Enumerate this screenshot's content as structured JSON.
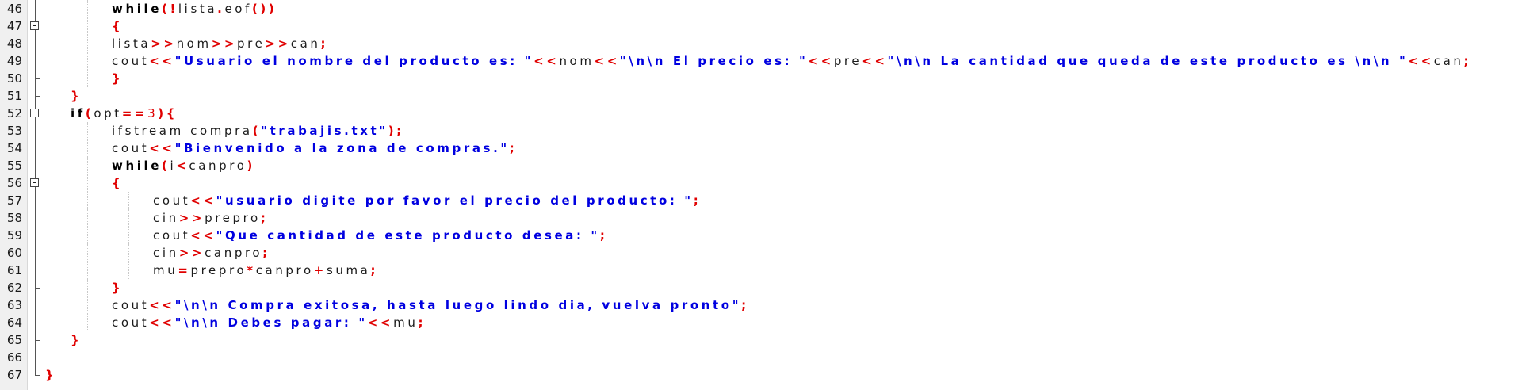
{
  "editor": {
    "lines": [
      {
        "num": "46",
        "indent": 2,
        "fold": "line",
        "tokens": [
          {
            "t": "kw",
            "v": "while"
          },
          {
            "t": "op",
            "v": "(!"
          },
          {
            "t": "id",
            "v": "lista"
          },
          {
            "t": "op",
            "v": "."
          },
          {
            "t": "id",
            "v": "eof"
          },
          {
            "t": "op",
            "v": "())"
          }
        ]
      },
      {
        "num": "47",
        "indent": 2,
        "fold": "box",
        "tokens": [
          {
            "t": "op",
            "v": "{"
          }
        ]
      },
      {
        "num": "48",
        "indent": 2,
        "fold": "line",
        "tokens": [
          {
            "t": "id",
            "v": "lista"
          },
          {
            "t": "op",
            "v": ">>"
          },
          {
            "t": "id",
            "v": "nom"
          },
          {
            "t": "op",
            "v": ">>"
          },
          {
            "t": "id",
            "v": "pre"
          },
          {
            "t": "op",
            "v": ">>"
          },
          {
            "t": "id",
            "v": "can"
          },
          {
            "t": "op",
            "v": ";"
          }
        ]
      },
      {
        "num": "49",
        "indent": 2,
        "fold": "line",
        "tokens": [
          {
            "t": "id",
            "v": "cout"
          },
          {
            "t": "op",
            "v": "<<"
          },
          {
            "t": "str",
            "v": "\"Usuario el nombre del producto es: \""
          },
          {
            "t": "op",
            "v": "<<"
          },
          {
            "t": "id",
            "v": "nom"
          },
          {
            "t": "op",
            "v": "<<"
          },
          {
            "t": "str",
            "v": "\"\\n\\n El precio es: \""
          },
          {
            "t": "op",
            "v": "<<"
          },
          {
            "t": "id",
            "v": "pre"
          },
          {
            "t": "op",
            "v": "<<"
          },
          {
            "t": "str",
            "v": "\"\\n\\n La cantidad que queda de este producto es \\n\\n \""
          },
          {
            "t": "op",
            "v": "<<"
          },
          {
            "t": "id",
            "v": "can"
          },
          {
            "t": "op",
            "v": ";"
          }
        ]
      },
      {
        "num": "50",
        "indent": 2,
        "fold": "tick",
        "tokens": [
          {
            "t": "op",
            "v": "}"
          }
        ]
      },
      {
        "num": "51",
        "indent": 1,
        "fold": "tick",
        "tokens": [
          {
            "t": "op",
            "v": "}"
          }
        ]
      },
      {
        "num": "52",
        "indent": 1,
        "fold": "box",
        "tokens": [
          {
            "t": "kw",
            "v": "if"
          },
          {
            "t": "op",
            "v": "("
          },
          {
            "t": "id",
            "v": "opt"
          },
          {
            "t": "op",
            "v": "=="
          },
          {
            "t": "num",
            "v": "3"
          },
          {
            "t": "op",
            "v": "){"
          }
        ]
      },
      {
        "num": "53",
        "indent": 2,
        "fold": "line",
        "tokens": [
          {
            "t": "id",
            "v": "ifstream compra"
          },
          {
            "t": "op",
            "v": "("
          },
          {
            "t": "str",
            "v": "\"trabajis.txt\""
          },
          {
            "t": "op",
            "v": ");"
          }
        ]
      },
      {
        "num": "54",
        "indent": 2,
        "fold": "line",
        "tokens": [
          {
            "t": "id",
            "v": "cout"
          },
          {
            "t": "op",
            "v": "<<"
          },
          {
            "t": "str",
            "v": "\"Bienvenido a la zona de compras.\""
          },
          {
            "t": "op",
            "v": ";"
          }
        ]
      },
      {
        "num": "55",
        "indent": 2,
        "fold": "line",
        "tokens": [
          {
            "t": "kw",
            "v": "while"
          },
          {
            "t": "op",
            "v": "("
          },
          {
            "t": "id",
            "v": "i"
          },
          {
            "t": "op",
            "v": "<"
          },
          {
            "t": "id",
            "v": "canpro"
          },
          {
            "t": "op",
            "v": ")"
          }
        ]
      },
      {
        "num": "56",
        "indent": 2,
        "fold": "box",
        "tokens": [
          {
            "t": "op",
            "v": "{"
          }
        ]
      },
      {
        "num": "57",
        "indent": 3,
        "fold": "line",
        "tokens": [
          {
            "t": "id",
            "v": "cout"
          },
          {
            "t": "op",
            "v": "<<"
          },
          {
            "t": "str",
            "v": "\"usuario digite por favor el precio del producto: \""
          },
          {
            "t": "op",
            "v": ";"
          }
        ]
      },
      {
        "num": "58",
        "indent": 3,
        "fold": "line",
        "tokens": [
          {
            "t": "id",
            "v": "cin"
          },
          {
            "t": "op",
            "v": ">>"
          },
          {
            "t": "id",
            "v": "prepro"
          },
          {
            "t": "op",
            "v": ";"
          }
        ]
      },
      {
        "num": "59",
        "indent": 3,
        "fold": "line",
        "tokens": [
          {
            "t": "id",
            "v": "cout"
          },
          {
            "t": "op",
            "v": "<<"
          },
          {
            "t": "str",
            "v": "\"Que cantidad de este producto desea: \""
          },
          {
            "t": "op",
            "v": ";"
          }
        ]
      },
      {
        "num": "60",
        "indent": 3,
        "fold": "line",
        "tokens": [
          {
            "t": "id",
            "v": "cin"
          },
          {
            "t": "op",
            "v": ">>"
          },
          {
            "t": "id",
            "v": "canpro"
          },
          {
            "t": "op",
            "v": ";"
          }
        ]
      },
      {
        "num": "61",
        "indent": 3,
        "fold": "line",
        "tokens": [
          {
            "t": "id",
            "v": "mu"
          },
          {
            "t": "op",
            "v": "="
          },
          {
            "t": "id",
            "v": "prepro"
          },
          {
            "t": "op",
            "v": "*"
          },
          {
            "t": "id",
            "v": "canpro"
          },
          {
            "t": "op",
            "v": "+"
          },
          {
            "t": "id",
            "v": "suma"
          },
          {
            "t": "op",
            "v": ";"
          }
        ]
      },
      {
        "num": "62",
        "indent": 2,
        "fold": "tick",
        "tokens": [
          {
            "t": "op",
            "v": "}"
          }
        ]
      },
      {
        "num": "63",
        "indent": 2,
        "fold": "line",
        "tokens": [
          {
            "t": "id",
            "v": "cout"
          },
          {
            "t": "op",
            "v": "<<"
          },
          {
            "t": "str",
            "v": "\"\\n\\n Compra exitosa, hasta luego lindo dia, vuelva pronto\""
          },
          {
            "t": "op",
            "v": ";"
          }
        ]
      },
      {
        "num": "64",
        "indent": 2,
        "fold": "line",
        "tokens": [
          {
            "t": "id",
            "v": "cout"
          },
          {
            "t": "op",
            "v": "<<"
          },
          {
            "t": "str",
            "v": "\"\\n\\n Debes pagar: \""
          },
          {
            "t": "op",
            "v": "<<"
          },
          {
            "t": "id",
            "v": "mu"
          },
          {
            "t": "op",
            "v": ";"
          }
        ]
      },
      {
        "num": "65",
        "indent": 1,
        "fold": "tick",
        "tokens": [
          {
            "t": "op",
            "v": "}"
          }
        ]
      },
      {
        "num": "66",
        "indent": 0,
        "fold": "line",
        "tokens": []
      },
      {
        "num": "67",
        "indent": 0,
        "fold": "end",
        "tokens": [
          {
            "t": "op",
            "v": "}"
          }
        ]
      }
    ]
  }
}
